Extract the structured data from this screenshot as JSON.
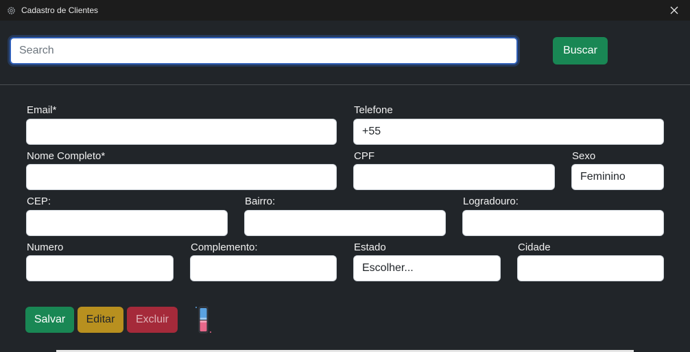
{
  "window": {
    "title": "Cadastro de Clientes",
    "app_icon": "gear-icon",
    "close_icon": "close-icon"
  },
  "search": {
    "placeholder": "Search",
    "value": "",
    "button_label": "Buscar"
  },
  "form": {
    "email_label": "Email*",
    "email_value": "",
    "telefone_label": "Telefone",
    "telefone_value": "+55",
    "nome_label": "Nome Completo*",
    "nome_value": "",
    "cpf_label": "CPF",
    "cpf_value": "",
    "sexo_label": "Sexo",
    "sexo_value": "Feminino",
    "cep_label": "CEP:",
    "cep_value": "",
    "bairro_label": "Bairro:",
    "bairro_value": "",
    "logradouro_label": "Logradouro:",
    "logradouro_value": "",
    "numero_label": "Numero",
    "numero_value": "",
    "complemento_label": "Complemento:",
    "complemento_value": "",
    "estado_label": "Estado",
    "estado_value": "Escolher...",
    "cidade_label": "Cidade",
    "cidade_value": ""
  },
  "actions": {
    "salvar": "Salvar",
    "editar": "Editar",
    "excluir": "Excluir",
    "theme_icon": "theme-toggle-icon"
  },
  "colors": {
    "success": "#198754",
    "warning": "#b8901f",
    "danger": "#a52a3a",
    "background": "#212529",
    "focus": "#2f5fb8"
  }
}
